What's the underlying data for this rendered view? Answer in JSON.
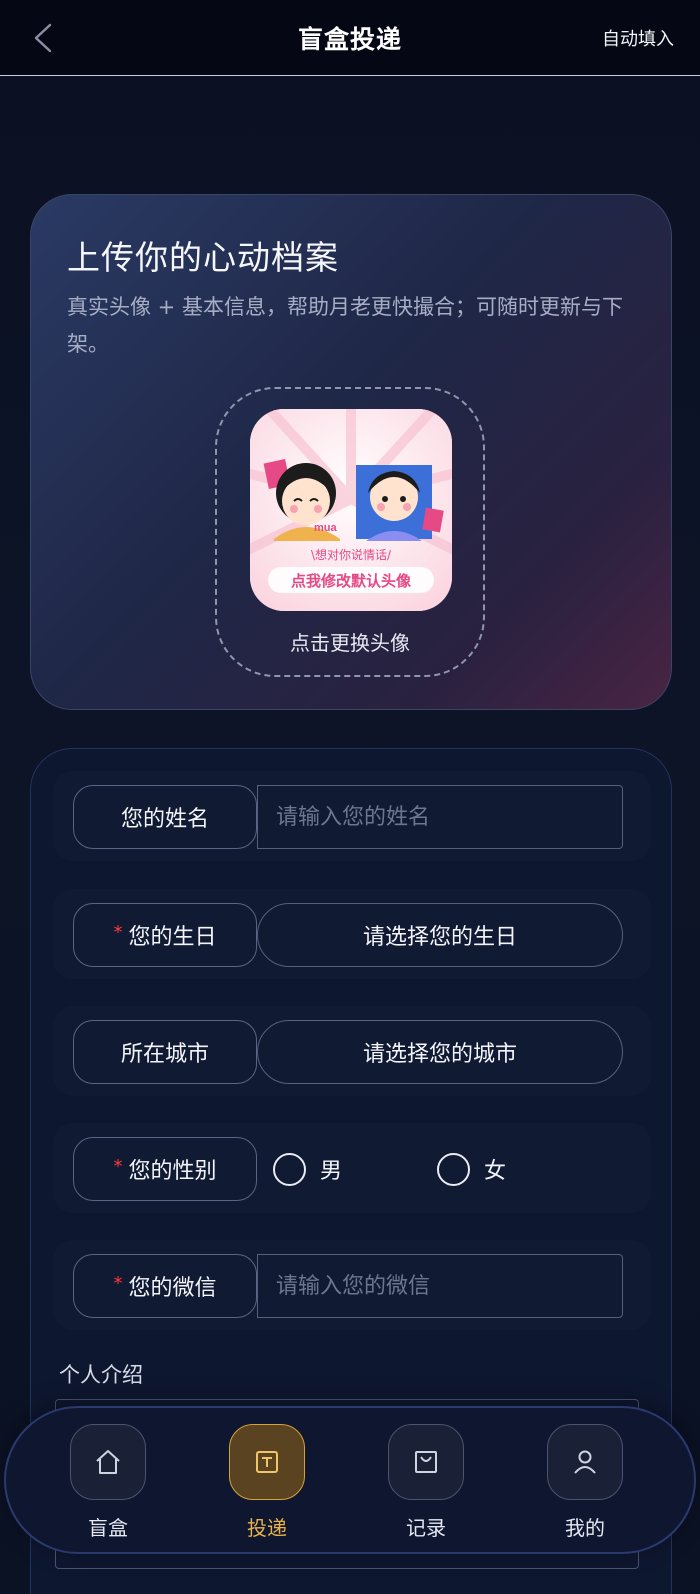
{
  "header": {
    "title": "盲盒投递",
    "autofill_label": "自动填入"
  },
  "hero": {
    "title": "上传你的心动档案",
    "description": "真实头像 + 基本信息，帮助月老更快撮合；可随时更新与下架。",
    "avatar_caption": "点击更换头像",
    "avatar_text_line1": "\\想对你说情话/",
    "avatar_text_line2": "点我修改默认头像",
    "avatar_sticker": "mua"
  },
  "form": {
    "name": {
      "label": "您的姓名",
      "placeholder": "请输入您的姓名",
      "required": false
    },
    "birthday": {
      "label": "您的生日",
      "value": "请选择您的生日",
      "required": true
    },
    "city": {
      "label": "所在城市",
      "value": "请选择您的城市",
      "required": false
    },
    "gender": {
      "label": "您的性别",
      "required": true,
      "options": [
        "男",
        "女"
      ]
    },
    "wechat": {
      "label": "您的微信",
      "placeholder": "请输入您的微信",
      "required": true
    },
    "intro_label": "个人介绍",
    "required_mark": "*"
  },
  "tabbar": {
    "items": [
      {
        "label": "盲盒",
        "icon": "home-icon",
        "active": false
      },
      {
        "label": "投递",
        "icon": "deliver-icon",
        "active": true
      },
      {
        "label": "记录",
        "icon": "bag-icon",
        "active": false
      },
      {
        "label": "我的",
        "icon": "user-icon",
        "active": false
      }
    ]
  },
  "colors": {
    "accent": "#e9b24a",
    "required": "#ff3b3b",
    "background": "#0b1022"
  }
}
